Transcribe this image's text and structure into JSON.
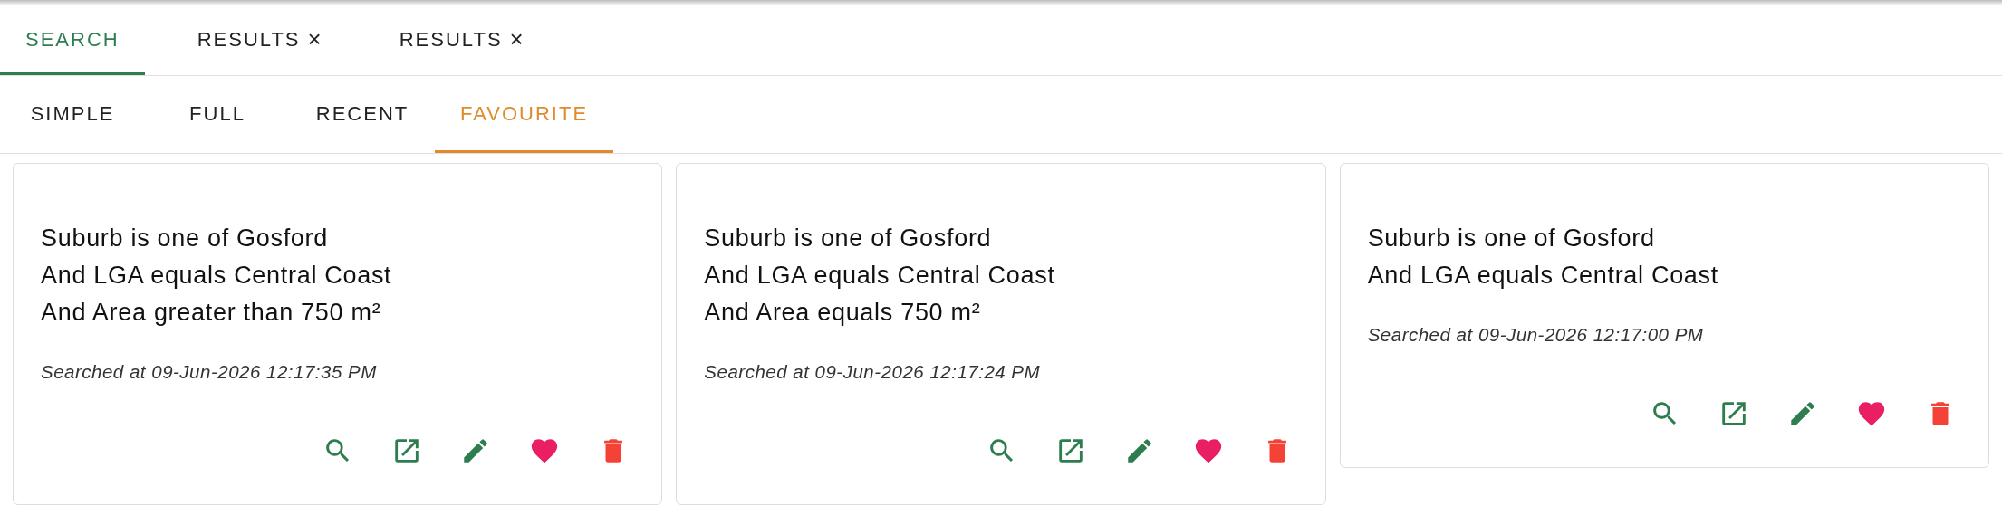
{
  "tabs": [
    {
      "label": "SEARCH",
      "closable": false,
      "selected": true
    },
    {
      "label": "RESULTS",
      "closable": true,
      "close_glyph": "×",
      "selected": false
    },
    {
      "label": "RESULTS",
      "closable": true,
      "close_glyph": "×",
      "selected": false
    }
  ],
  "subtabs": [
    {
      "label": "SIMPLE",
      "selected": false
    },
    {
      "label": "FULL",
      "selected": false
    },
    {
      "label": "RECENT",
      "selected": false
    },
    {
      "label": "FAVOURITE",
      "selected": true
    }
  ],
  "cards": [
    {
      "criteria": [
        "Suburb is one of Gosford",
        "And LGA equals Central Coast",
        "And Area greater than 750 m²"
      ],
      "timestamp": "Searched at 09-Jun-2026 12:17:35 PM",
      "favourite": true
    },
    {
      "criteria": [
        "Suburb is one of Gosford",
        "And LGA equals Central Coast",
        "And Area equals 750 m²"
      ],
      "timestamp": "Searched at 09-Jun-2026 12:17:24 PM",
      "favourite": true
    },
    {
      "criteria": [
        "Suburb is one of Gosford",
        "And LGA equals Central Coast"
      ],
      "timestamp": "Searched at 09-Jun-2026 12:17:00 PM",
      "favourite": true
    }
  ]
}
